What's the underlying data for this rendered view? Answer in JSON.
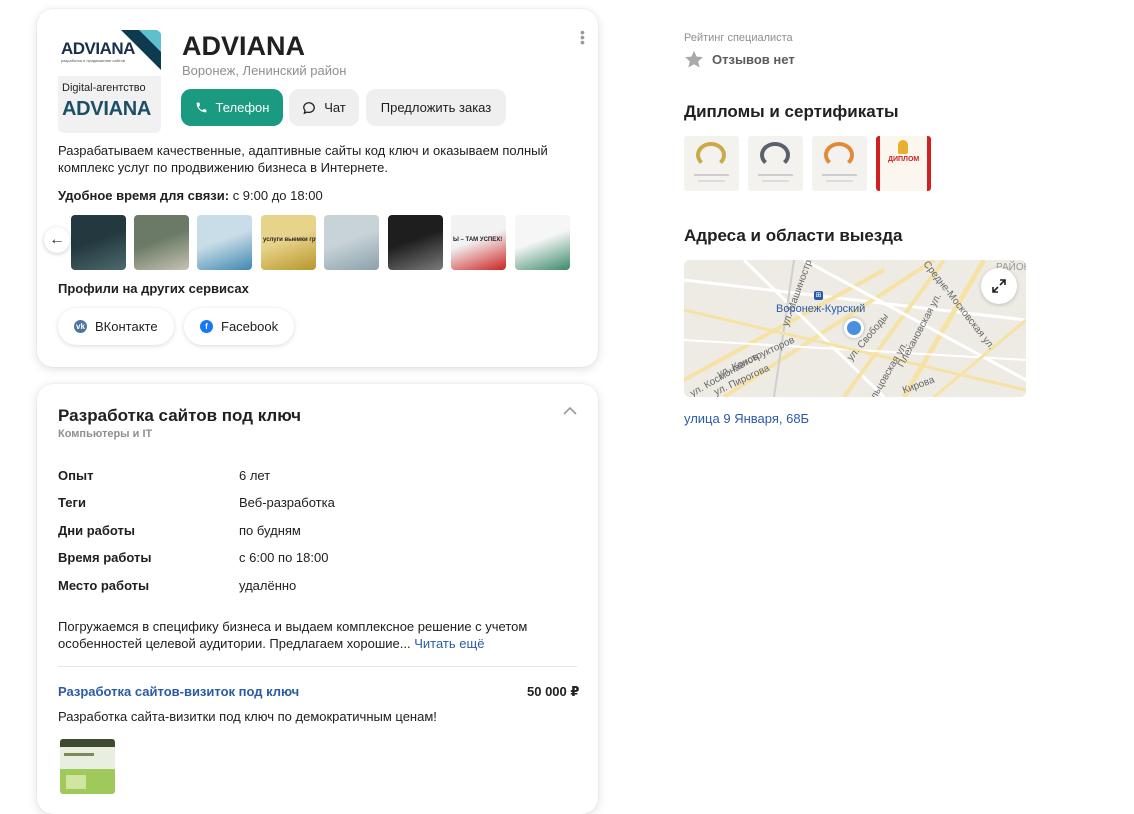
{
  "profile": {
    "logo": {
      "brand_top": "ADVIANA",
      "brand_top_sub": "разработка и продвижение сайтов",
      "tagline": "Digital-агентство",
      "brand_bottom": "ADVIANA"
    },
    "name": "ADVIANA",
    "location": "Воронеж, Ленинский район",
    "menu_icon": "kebab-icon",
    "buttons": {
      "phone": "Телефон",
      "chat": "Чат",
      "order": "Предложить заказ"
    },
    "description": "Разрабатываем качественные, адаптивные сайты код ключ и оказываем полный комплекс услуг по продвижению бизнеса в Интернете.",
    "contact_time_label": "Удобное время для связи:",
    "contact_time_value": "с 9:00 до 18:00",
    "gallery_thumbs": [
      {
        "caption": "",
        "colors": [
          "#23383f",
          "#4c6a6e"
        ]
      },
      {
        "caption": "",
        "colors": [
          "#6a7a66",
          "#c7c3b3"
        ]
      },
      {
        "caption": "",
        "colors": [
          "#c9dde8",
          "#3f87b0"
        ]
      },
      {
        "caption": "услуги выемки грунта",
        "colors": [
          "#e8d38a",
          "#b8962c"
        ]
      },
      {
        "caption": "",
        "colors": [
          "#c8d3d8",
          "#8aa0aa"
        ]
      },
      {
        "caption": "",
        "colors": [
          "#1e1e1e",
          "#7a7a7a"
        ]
      },
      {
        "caption": "Ы – ТАМ УСПЕХ!",
        "colors": [
          "#f2f2f2",
          "#cc2222"
        ]
      },
      {
        "caption": "",
        "colors": [
          "#f6f6f6",
          "#3a8a6a"
        ]
      }
    ],
    "other_profiles_label": "Профили на других сервисах",
    "socials": [
      {
        "label": "ВКонтакте",
        "icon": "vk-icon",
        "color": "#4c75a3"
      },
      {
        "label": "Facebook",
        "icon": "facebook-icon",
        "color": "#1877f2"
      }
    ]
  },
  "service": {
    "title": "Разработка сайтов под ключ",
    "category": "Компьютеры и IT",
    "details": [
      {
        "key": "Опыт",
        "value": "6 лет"
      },
      {
        "key": "Теги",
        "value": "Веб-разработка"
      },
      {
        "key": "Дни работы",
        "value": "по будням"
      },
      {
        "key": "Время работы",
        "value": "с 6:00 по 18:00"
      },
      {
        "key": "Место работы",
        "value": "удалённо"
      }
    ],
    "text": "Погружаемся в специфику бизнеса и выдаем комплексное решение с учетом особенностей целевой аудитории. Предлагаем хорошие...",
    "read_more": "Читать ещё",
    "offer": {
      "title": "Разработка сайтов-визиток под ключ",
      "price": "50 000 ₽",
      "description": "Разработка сайта-визитки под ключ по демократичным ценам!"
    }
  },
  "sidebar": {
    "rating_label": "Рейтинг специалиста",
    "rating_value": "Отзывов нет",
    "diplomas_title": "Дипломы и сертификаты",
    "certificates": [
      {
        "ring": "#c9a94a"
      },
      {
        "ring": "#59626a"
      },
      {
        "ring": "#e08a3a"
      },
      {
        "ring": "#d02020",
        "label": "ДИПЛОМ"
      }
    ],
    "addresses_title": "Адреса и области выезда",
    "map": {
      "station": "Воронеж-Курский",
      "streets": [
        "ул. Конструкторов",
        "ул. Пирогова",
        "ул. Свободы",
        "Кольцовская ул.",
        "Плехановская ул.",
        "Средне-Московская ул.",
        "Кирова",
        "ул. Космонавтов",
        "ул. Машиностроителей",
        "РАЙОН"
      ]
    },
    "address": "улица 9 Января, 68Б"
  }
}
